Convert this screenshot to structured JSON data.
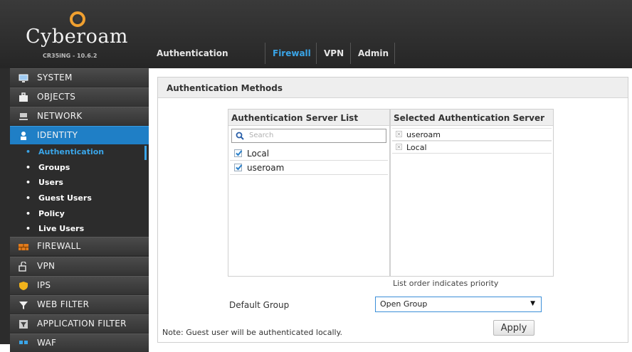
{
  "header": {
    "logo": "Cyberoam",
    "model": "CR35iNG - 10.6.2",
    "tabs": [
      {
        "label": "Authentication Server",
        "active": false
      },
      {
        "label": "Firewall",
        "active": true
      },
      {
        "label": "VPN",
        "active": false
      },
      {
        "label": "Admin",
        "active": false
      }
    ]
  },
  "sidebar": {
    "items": [
      {
        "label": "SYSTEM",
        "icon": "monitor-icon"
      },
      {
        "label": "OBJECTS",
        "icon": "briefcase-icon"
      },
      {
        "label": "NETWORK",
        "icon": "network-icon"
      },
      {
        "label": "IDENTITY",
        "icon": "user-icon",
        "active": true
      },
      {
        "label": "FIREWALL",
        "icon": "firewall-icon"
      },
      {
        "label": "VPN",
        "icon": "vpn-icon"
      },
      {
        "label": "IPS",
        "icon": "shield-icon"
      },
      {
        "label": "WEB FILTER",
        "icon": "filter-icon"
      },
      {
        "label": "APPLICATION FILTER",
        "icon": "app-filter-icon"
      },
      {
        "label": "WAF",
        "icon": "waf-icon"
      }
    ],
    "identity_sub": [
      {
        "label": "Authentication",
        "active": true
      },
      {
        "label": "Groups"
      },
      {
        "label": "Users"
      },
      {
        "label": "Guest Users"
      },
      {
        "label": "Policy"
      },
      {
        "label": "Live Users"
      }
    ]
  },
  "main": {
    "panel_title": "Authentication Methods",
    "server_list_header": "Authentication Server List",
    "selected_header": "Selected Authentication Server",
    "search_placeholder": "Search",
    "server_list": [
      {
        "label": "Local",
        "checked": true
      },
      {
        "label": "useroam",
        "checked": true
      }
    ],
    "selected_list": [
      "useroam",
      "Local"
    ],
    "priority_note": "List order indicates priority",
    "default_group_label": "Default Group",
    "default_group_value": "Open Group",
    "apply_label": "Apply",
    "note": "Note: Guest user will be authenticated locally."
  },
  "colors": {
    "accent": "#1f7fc6",
    "active_text": "#3aa5e8",
    "header_bg": "#2c2c2c"
  }
}
